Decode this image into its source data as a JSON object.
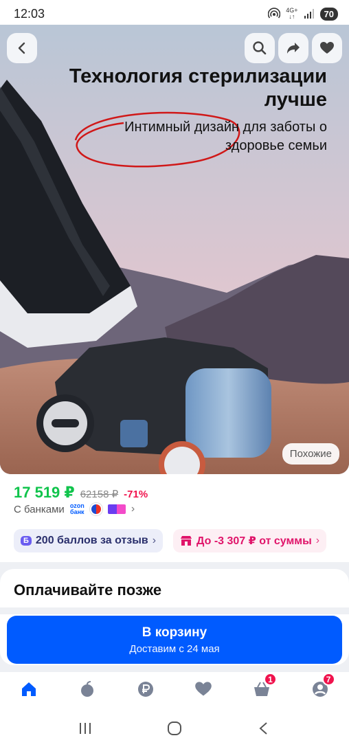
{
  "status_bar": {
    "time": "12:03",
    "network": "4G+",
    "battery": "70",
    "icons": [
      "hotspot-icon",
      "signal-icon",
      "battery-icon"
    ]
  },
  "hero": {
    "title": "Технология стерилизации лучше",
    "subtitle": "Интимный дизайн для заботы о здоровье семьи",
    "similar_label": "Похожие",
    "buttons": [
      "back-icon",
      "search-icon",
      "share-icon",
      "heart-icon"
    ]
  },
  "price": {
    "current": "17 519 ₽",
    "old": "62158 ₽",
    "discount": "-71%",
    "with_banks": "С банками",
    "ozon_bank_line1": "ozon",
    "ozon_bank_line2": "банк"
  },
  "chips": {
    "points_badge": "Б",
    "points_label": "200 баллов за отзыв",
    "sale_label": "До -3 307 ₽ от суммы"
  },
  "pay_later": {
    "title": "Оплачивайте позже"
  },
  "cart_button": {
    "title": "В корзину",
    "subtitle": "Доставим с 24 мая"
  },
  "bottom_nav": {
    "items": [
      "home-icon",
      "fresh-icon",
      "ruble-icon",
      "favorites-icon",
      "cart-icon",
      "profile-icon"
    ],
    "cart_badge": "1",
    "profile_badge": "7"
  },
  "colors": {
    "accent": "#005bff",
    "price_green": "#10c44c",
    "discount_red": "#f0134d",
    "sale_pink": "#e0146a"
  }
}
